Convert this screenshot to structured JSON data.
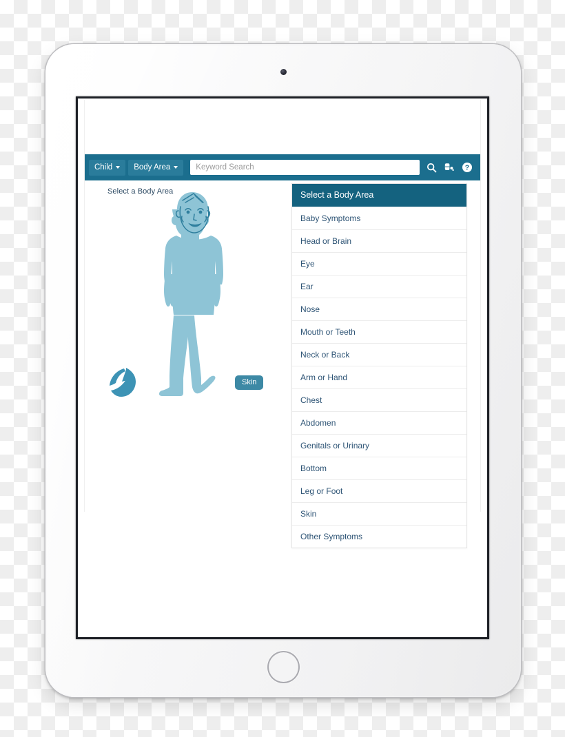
{
  "device": {
    "type": "tablet",
    "camera_icon": "camera-dot",
    "home_button_icon": "home-button-circle"
  },
  "toolbar": {
    "audience_button": "Child",
    "body_area_button": "Body Area",
    "caret_icon": "chevron-down-icon",
    "search": {
      "placeholder": "Keyword Search",
      "value": ""
    },
    "icons": [
      {
        "name": "search-icon",
        "label": "Search"
      },
      {
        "name": "medication-pill-icon",
        "label": "Medication"
      },
      {
        "name": "help-question-icon",
        "label": "Help"
      }
    ]
  },
  "content": {
    "instruction": "Select a Body Area",
    "figure": {
      "name": "child-body-figure",
      "color": "#8ec4d6",
      "outline_color": "#2f7f9e"
    },
    "rotate_control": {
      "name": "rotate-figure-arrow",
      "color": "#3d93b5"
    },
    "hotspot": {
      "label": "Skin",
      "color": "#3d89a5"
    }
  },
  "area_list": {
    "header": "Select a Body Area",
    "header_bg": "#14627f",
    "items": [
      "Baby Symptoms",
      "Head or Brain",
      "Eye",
      "Ear",
      "Nose",
      "Mouth or Teeth",
      "Neck or Back",
      "Arm or Hand",
      "Chest",
      "Abdomen",
      "Genitals or Urinary",
      "Bottom",
      "Leg or Foot",
      "Skin",
      "Other Symptoms"
    ]
  },
  "colors": {
    "toolbar_bg": "#1b6e8e",
    "toolbar_button_bg": "#2a7c9b",
    "list_header_bg": "#14627f",
    "list_text": "#2f5576",
    "figure_fill": "#8ec4d6"
  }
}
